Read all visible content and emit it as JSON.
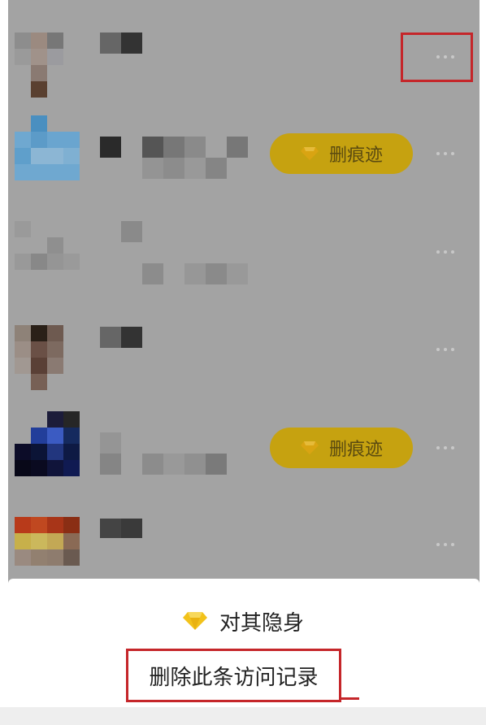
{
  "colors": {
    "overlay": "#a3a3a3",
    "vip_button": "#c6a210",
    "highlight_red": "#c5262a",
    "gem_gold": "#f2c21a"
  },
  "list": {
    "items": [
      {
        "index": 0,
        "has_delete_trace": false
      },
      {
        "index": 1,
        "has_delete_trace": true,
        "delete_trace_label": "删痕迹"
      },
      {
        "index": 2,
        "has_delete_trace": false
      },
      {
        "index": 3,
        "has_delete_trace": false
      },
      {
        "index": 4,
        "has_delete_trace": true,
        "delete_trace_label": "删痕迹"
      },
      {
        "index": 5,
        "has_delete_trace": false
      }
    ]
  },
  "sheet": {
    "hide_label": "对其隐身",
    "delete_record_label": "删除此条访问记录"
  },
  "icons": {
    "more": "more-horizontal-icon",
    "vip": "diamond-icon"
  }
}
